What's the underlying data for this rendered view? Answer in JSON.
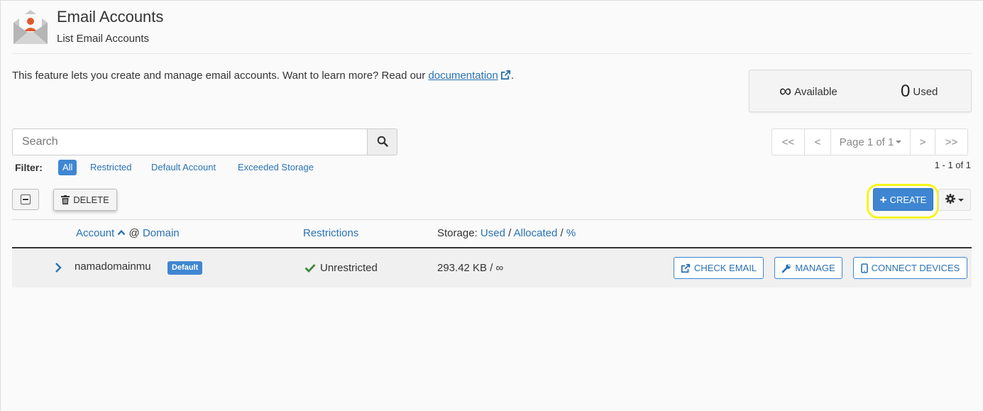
{
  "header": {
    "title": "Email Accounts",
    "subtitle": "List Email Accounts"
  },
  "intro": {
    "text": "This feature lets you create and manage email accounts. Want to learn more? Read our",
    "link": "documentation",
    "after": "."
  },
  "stats": {
    "available_value": "∞",
    "available_label": "Available",
    "used_value": "0",
    "used_label": "Used"
  },
  "search": {
    "placeholder": "Search"
  },
  "pagination": {
    "first": "<<",
    "prev": "<",
    "page_label": "Page 1 of 1",
    "next": ">",
    "last": ">>",
    "range": "1 - 1 of 1"
  },
  "filter": {
    "label": "Filter:",
    "options": [
      "All",
      "Restricted",
      "Default Account",
      "Exceeded Storage"
    ],
    "selected": "All"
  },
  "actions": {
    "delete_label": "DELETE",
    "create_label": "CREATE"
  },
  "table": {
    "headers": {
      "account": "Account",
      "at": "@",
      "domain": "Domain",
      "restrictions": "Restrictions",
      "storage_prefix": "Storage:",
      "storage_used": "Used",
      "storage_sep1": "/",
      "storage_allocated": "Allocated",
      "storage_sep2": "/",
      "storage_percent": "%"
    },
    "rows": [
      {
        "account": "namadomainmu",
        "badge": "Default",
        "restriction": "Unrestricted",
        "storage": "293.42 KB / ∞",
        "buttons": [
          "CHECK EMAIL",
          "MANAGE",
          "CONNECT DEVICES"
        ]
      }
    ]
  },
  "colors": {
    "accent": "#3f86d2",
    "link": "#2a72b5",
    "highlight": "#f5f51a",
    "success": "#3c8a3c"
  }
}
